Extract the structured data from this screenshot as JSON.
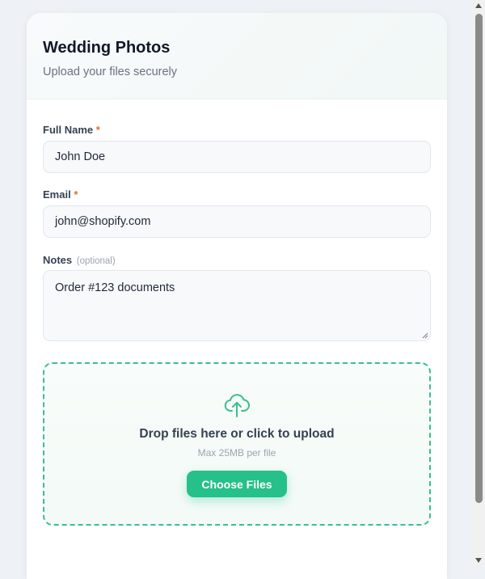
{
  "form": {
    "title": "Wedding Photos",
    "subtitle": "Upload your files securely"
  },
  "fields": {
    "full_name": {
      "label": "Full Name",
      "required_mark": "*",
      "value": "John Doe"
    },
    "email": {
      "label": "Email",
      "required_mark": "*",
      "value": "john@shopify.com"
    },
    "notes": {
      "label": "Notes",
      "optional_label": "(optional)",
      "value": "Order #123 documents"
    }
  },
  "upload": {
    "icon": "cloud-upload-icon",
    "title": "Drop files here or click to upload",
    "hint": "Max 25MB per file",
    "button_label": "Choose Files"
  },
  "colors": {
    "accent": "#26c08a",
    "required": "#e0702a",
    "dropzone_border": "#3bbf8c"
  }
}
